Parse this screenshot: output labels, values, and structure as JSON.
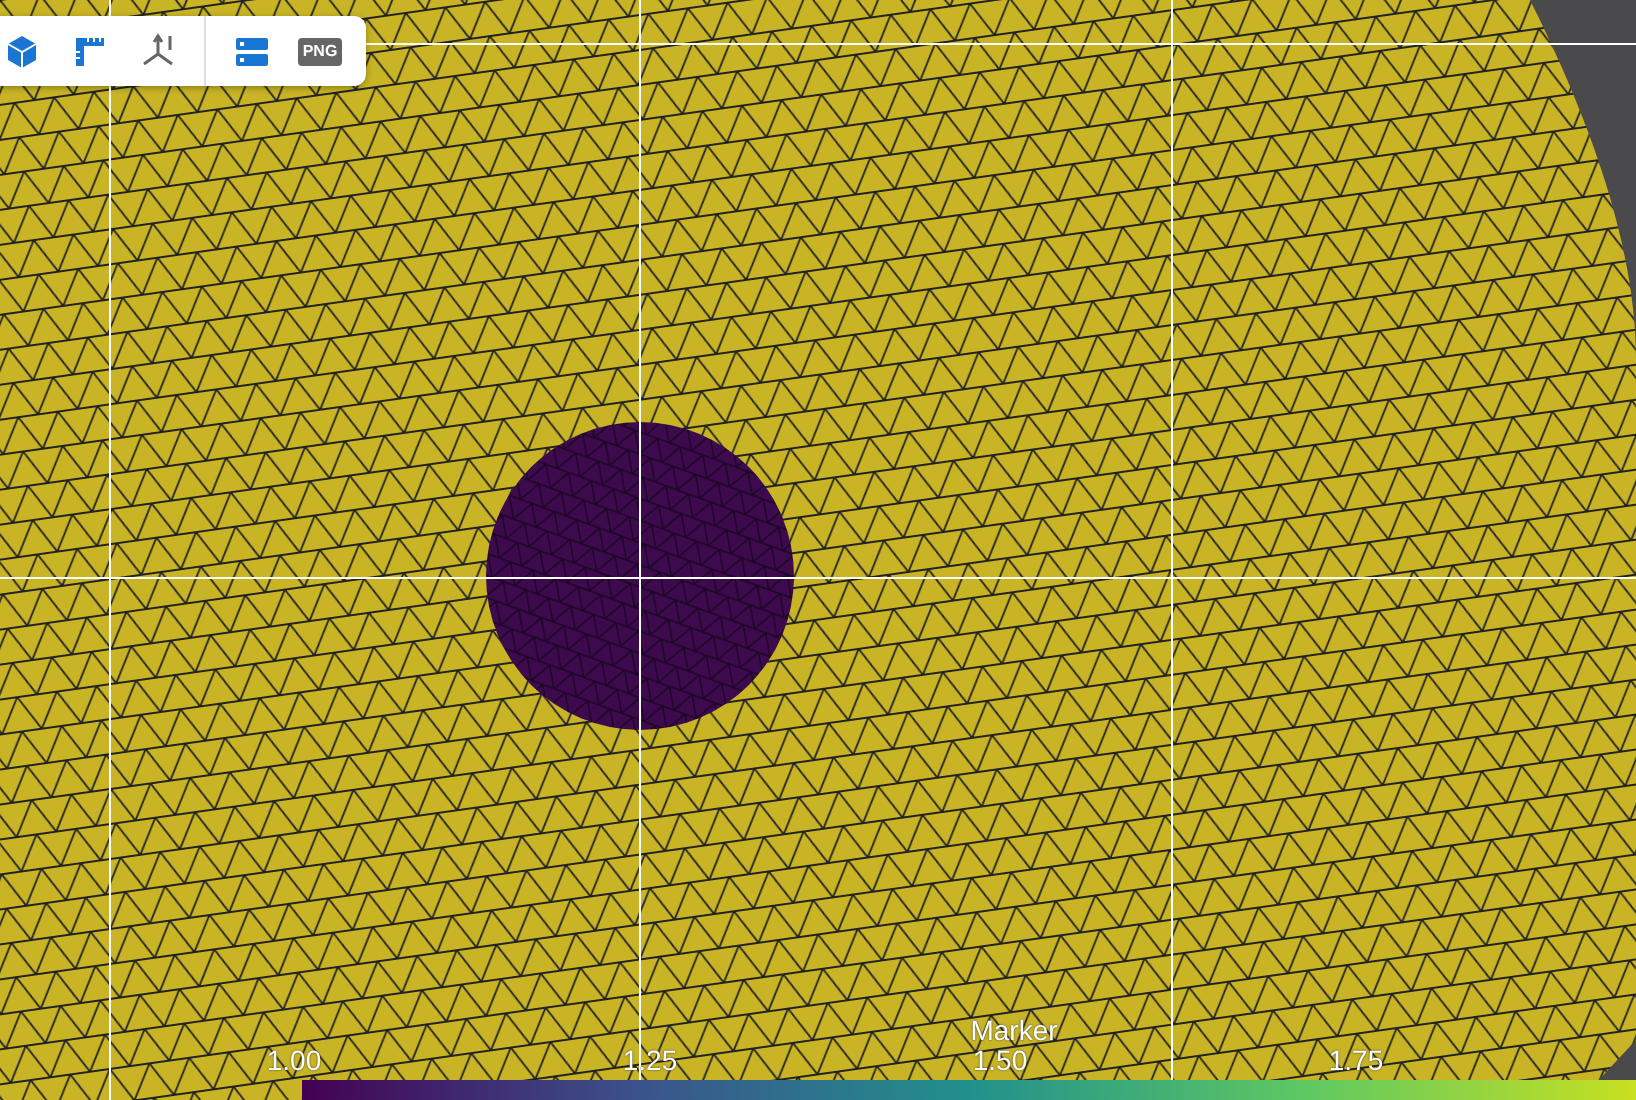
{
  "toolbar": {
    "export_label": "PNG"
  },
  "legend": {
    "title": "Marker",
    "ticks": [
      "1.00",
      "1.25",
      "1.50",
      "1.75"
    ]
  }
}
